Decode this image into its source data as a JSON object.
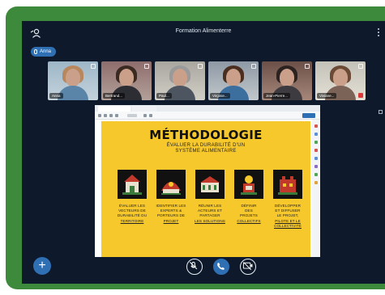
{
  "meeting": {
    "title": "Formation Alimenterre"
  },
  "speaker": {
    "name": "Anna"
  },
  "participants": [
    {
      "name": "Anna"
    },
    {
      "name": "Bertrand..."
    },
    {
      "name": "Paul..."
    },
    {
      "name": "Virginie..."
    },
    {
      "name": "Jean-Pierre..."
    },
    {
      "name": "Viviane..."
    }
  ],
  "slide": {
    "title": "MÉTHODOLOGIE",
    "subtitle_line1": "ÉVALUER LA DURABILITÉ D'UN",
    "subtitle_line2": "SYSTÈME ALIMENTAIRE",
    "steps": [
      {
        "line1": "ÉVALUER LES",
        "line2": "VECTEURS DE",
        "line3": "DURABILITÉ DU",
        "keyword": "TERRITOIRE"
      },
      {
        "line1": "IDENTIFIER LES",
        "line2": "EXPERTS &",
        "line3": "PORTEURS DE",
        "keyword": "PROJET"
      },
      {
        "line1": "RÉUNIR LES",
        "line2": "ACTEURS ET",
        "line3": "PARTAGER",
        "keyword": "LES SOLUTIONS"
      },
      {
        "line1": "DÉFINIR",
        "line2": "DES",
        "line3": "PROJETS",
        "keyword": "COLLECTIFS"
      },
      {
        "line1": "DÉVELOPPER",
        "line2": "ET DIFFUSER",
        "line3": "LE PROJET,",
        "keyword": "PILOTE ET LE COLLECTIVITÉ"
      }
    ]
  },
  "colors": {
    "frame": "#3e8a3c",
    "screen": "#0e1a2b",
    "accent": "#2f6fb3",
    "slide_bg": "#f7c82c"
  },
  "icons": {
    "menu": "user-icon",
    "more": "more-vertical-icon",
    "add": "plus-icon",
    "mic": "microphone-muted-icon",
    "phone": "phone-icon",
    "screen_share": "screen-share-icon"
  }
}
